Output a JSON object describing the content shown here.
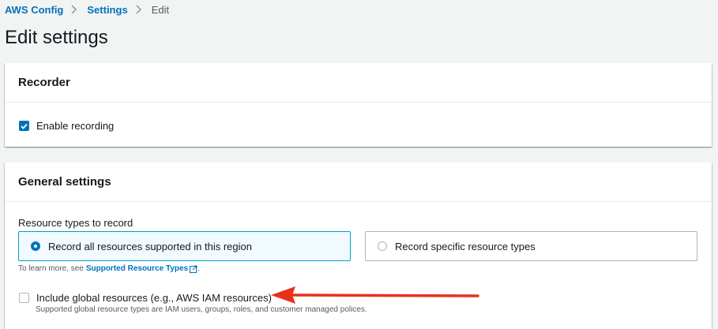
{
  "breadcrumb": {
    "items": [
      "AWS Config",
      "Settings"
    ],
    "current": "Edit"
  },
  "page": {
    "title": "Edit settings"
  },
  "recorder": {
    "header": "Recorder",
    "enable_recording": {
      "label": "Enable recording",
      "checked": true
    }
  },
  "general": {
    "header": "General settings",
    "resource_types_label": "Resource types to record",
    "options": [
      {
        "label": "Record all resources supported in this region",
        "selected": true
      },
      {
        "label": "Record specific resource types",
        "selected": false
      }
    ],
    "help_prefix": "To learn more, see",
    "help_link": "Supported Resource Types",
    "help_suffix": ".",
    "include_global": {
      "label": "Include global resources (e.g., AWS IAM resources)",
      "checked": false,
      "description": "Supported global resource types are IAM users, groups, roles, and customer managed polices."
    }
  },
  "colors": {
    "accent": "#0073bb",
    "annotation_arrow": "#e8311c",
    "background": "#f2f3f3"
  }
}
